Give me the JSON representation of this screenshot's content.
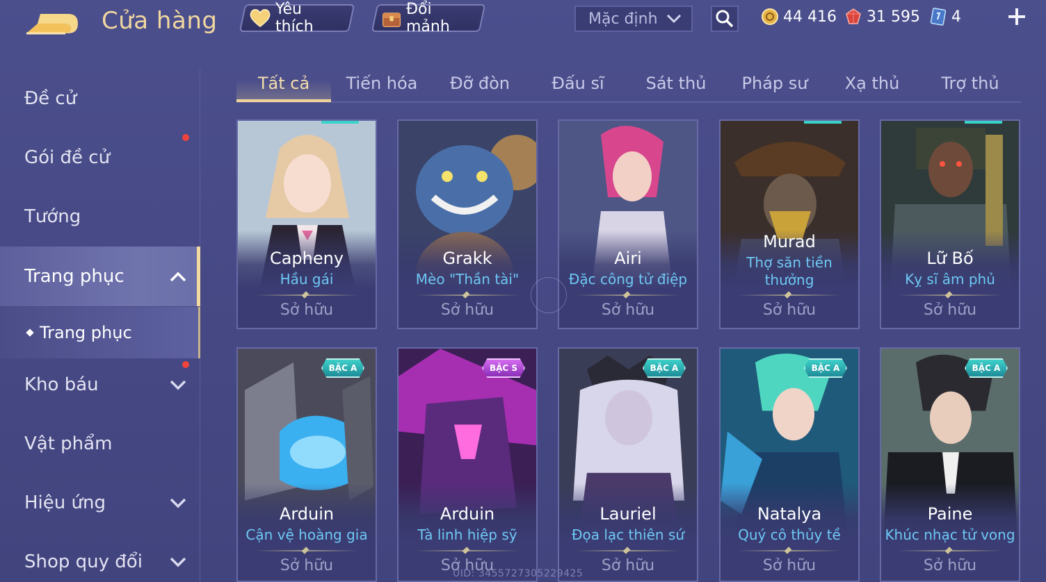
{
  "header": {
    "title": "Cửa hàng",
    "favorites_label": "Yêu thích",
    "exchange_label": "Đổi mảnh",
    "sort_label": "Mặc định",
    "currencies": [
      {
        "icon": "gold-coin-icon",
        "value": "44 416"
      },
      {
        "icon": "red-gem-icon",
        "value": "31 595"
      },
      {
        "icon": "card-icon",
        "value": "4"
      }
    ]
  },
  "sidebar": {
    "items": [
      {
        "label": "Đề cử",
        "dot": false
      },
      {
        "label": "Gói đề cử",
        "dot": true
      },
      {
        "label": "Tướng",
        "dot": false
      },
      {
        "label": "Trang phục",
        "expanded": true
      },
      {
        "label": "Kho báu",
        "dot": true
      },
      {
        "label": "Vật phẩm",
        "dot": false
      },
      {
        "label": "Hiệu ứng",
        "dot": false
      },
      {
        "label": "Shop quy đổi",
        "dot": false
      }
    ],
    "sub_item": "Trang phục"
  },
  "tabs": [
    "Tất cả",
    "Tiến hóa",
    "Đỡ đòn",
    "Đấu sĩ",
    "Sát thủ",
    "Pháp sư",
    "Xạ thủ",
    "Trợ thủ"
  ],
  "active_tab": "Tất cả",
  "cards": [
    {
      "hero": "Capheny",
      "skin": "Hầu gái",
      "status": "Sở hữu",
      "tier": ""
    },
    {
      "hero": "Grakk",
      "skin": "Mèo \"Thần tài\"",
      "status": "Sở hữu",
      "tier": ""
    },
    {
      "hero": "Airi",
      "skin": "Đặc công tử điệp",
      "status": "Sở hữu",
      "tier": ""
    },
    {
      "hero": "Murad",
      "skin": "Thợ săn tiền thưởng",
      "status": "Sở hữu",
      "tier": ""
    },
    {
      "hero": "Lữ Bố",
      "skin": "Kỵ sĩ âm phủ",
      "status": "Sở hữu",
      "tier": ""
    },
    {
      "hero": "Arduin",
      "skin": "Cận vệ hoàng gia",
      "status": "Sở hữu",
      "tier": "BẬC A"
    },
    {
      "hero": "Arduin",
      "skin": "Tà linh hiệp sỹ",
      "status": "Sở hữu",
      "tier": "BẬC S"
    },
    {
      "hero": "Lauriel",
      "skin": "Đọa lạc thiên sứ",
      "status": "Sở hữu",
      "tier": "BẬC A"
    },
    {
      "hero": "Natalya",
      "skin": "Quý cô thủy tề",
      "status": "Sở hữu",
      "tier": "BẬC A"
    },
    {
      "hero": "Paine",
      "skin": "Khúc nhạc tử vong",
      "status": "Sở hữu",
      "tier": "BẬC A"
    }
  ],
  "uid": "UID: 3455727305229425",
  "colors": {
    "accent": "#f1d59a",
    "skin_text": "#6ec8f4",
    "notify": "#f0433b"
  }
}
